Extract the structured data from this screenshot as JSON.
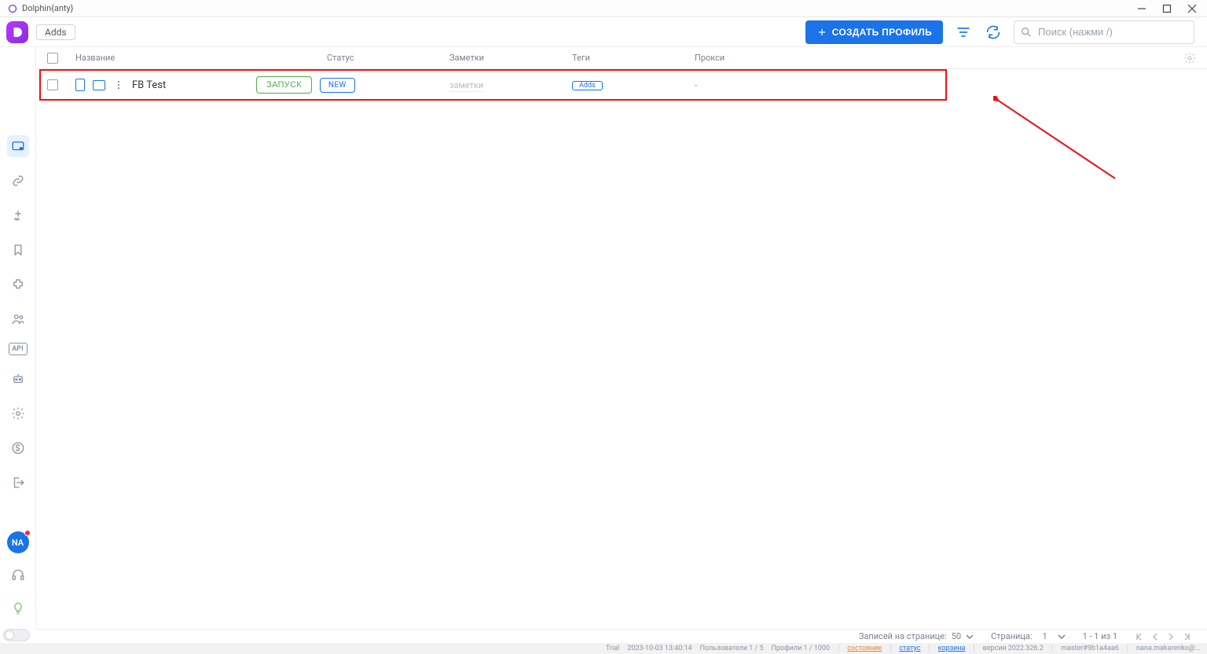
{
  "window": {
    "title": "Dolphin{anty}"
  },
  "appbar": {
    "adds_label": "Adds",
    "create_label": "СОЗДАТЬ ПРОФИЛЬ",
    "search_placeholder": "Поиск (нажми /)"
  },
  "sidebar": {
    "icons": [
      "browsers",
      "links",
      "star-plus",
      "bookmark",
      "extension",
      "users",
      "api",
      "robot",
      "settings",
      "billing",
      "logout"
    ],
    "avatar_initials": "NA"
  },
  "table": {
    "headers": {
      "name": "Название",
      "status": "Статус",
      "notes": "Заметки",
      "tags": "Теги",
      "proxy": "Прокси"
    },
    "rows": [
      {
        "name": "FB Test",
        "launch_label": "ЗАПУСК",
        "status_badge": "NEW",
        "notes_placeholder": "заметки",
        "tag_add_label": "Adds",
        "proxy": "-"
      }
    ]
  },
  "pager": {
    "per_page_label": "Записей на странице:",
    "per_page_value": "50",
    "page_label": "Страница:",
    "page_value": "1",
    "range": "1 - 1 из 1"
  },
  "status": {
    "trial": "Trial",
    "timestamp": "2023-10-03 13:40:14",
    "users": "Пользователи 1 / 5",
    "profiles": "Профили 1 / 1000",
    "link_state": "состояние",
    "link_status": "статус",
    "link_trash": "корзина",
    "version": "версия 2022.326.2",
    "build": "master#9b1a4aa6",
    "email": "nana.makarenko@..."
  }
}
